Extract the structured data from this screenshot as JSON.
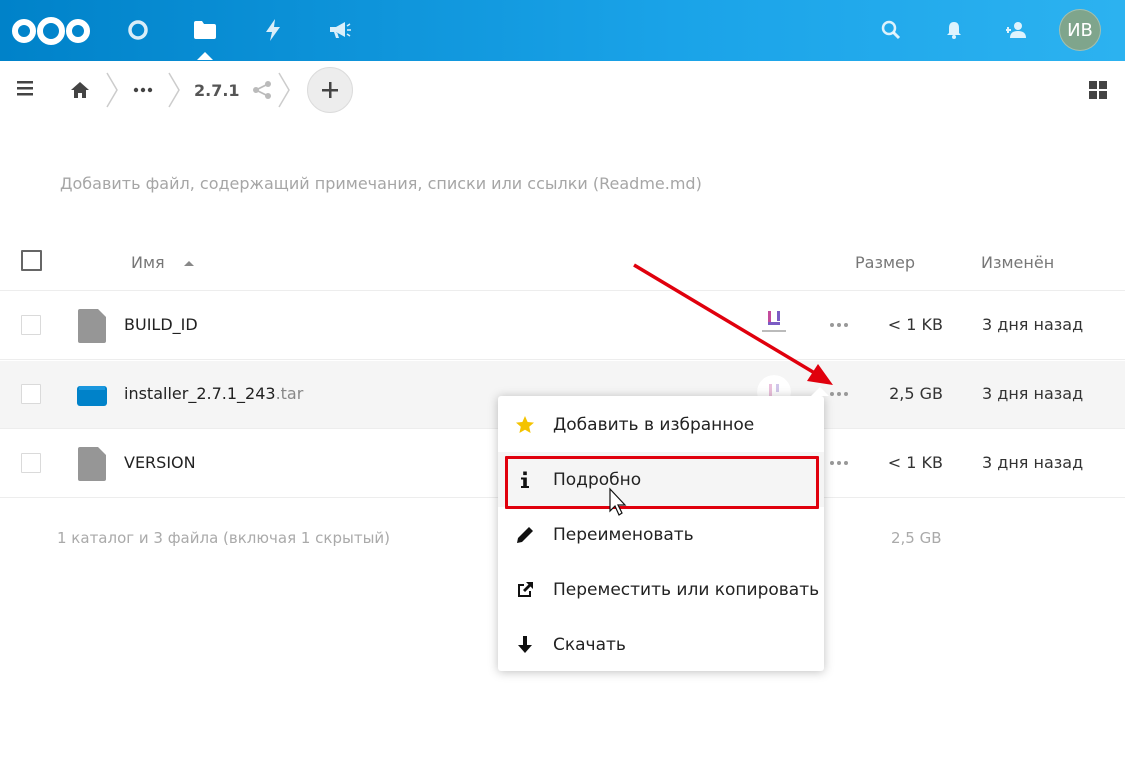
{
  "header": {
    "avatar_initials": "ИВ",
    "accent_color": "#0082c9",
    "apps": [
      "dashboard-icon",
      "files-icon",
      "activity-icon",
      "announcements-icon"
    ],
    "right_icons": [
      "search-icon",
      "bell-icon",
      "contacts-icon"
    ]
  },
  "breadcrumb": {
    "items": [
      "home-icon",
      "more-icon",
      "2.7.1"
    ],
    "current": "2.7.1"
  },
  "readme_hint": "Добавить файл, содержащий примечания, списки или ссылки (Readme.md)",
  "table": {
    "columns": {
      "name": "Имя",
      "size": "Размер",
      "modified": "Изменён"
    },
    "rows": [
      {
        "name": "BUILD_ID",
        "ext": "",
        "size": "< 1 KB",
        "modified": "3 дня назад",
        "type": "file"
      },
      {
        "name": "installer_2.7.1_243",
        "ext": ".tar",
        "size": "2,5 GB",
        "modified": "3 дня назад",
        "type": "archive"
      },
      {
        "name": "VERSION",
        "ext": "",
        "size": "< 1 KB",
        "modified": "3 дня назад",
        "type": "file"
      }
    ],
    "summary": "1 каталог и 3 файла (включая 1 скрытый)",
    "summary_size": "2,5 GB"
  },
  "menu": {
    "items": [
      {
        "label": "Добавить в избранное",
        "icon": "star-icon"
      },
      {
        "label": "Подробно",
        "icon": "info-icon"
      },
      {
        "label": "Переименовать",
        "icon": "pencil-icon"
      },
      {
        "label": "Переместить или копировать",
        "icon": "external-link-icon"
      },
      {
        "label": "Скачать",
        "icon": "download-icon"
      }
    ]
  }
}
